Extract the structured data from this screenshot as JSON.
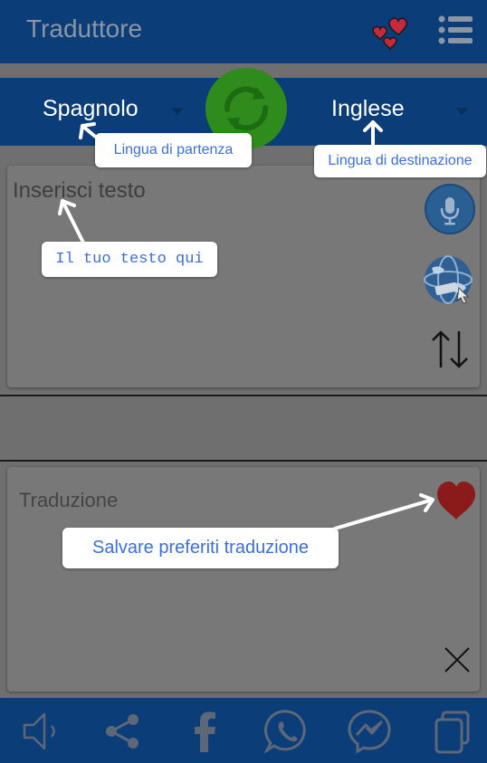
{
  "app": {
    "title": "Traduttore"
  },
  "languages": {
    "source": "Spagnolo",
    "target": "Inglese"
  },
  "input": {
    "placeholder": "Inserisci testo"
  },
  "output": {
    "label": "Traduzione"
  },
  "tooltips": {
    "source": "Lingua di partenza",
    "target": "Lingua di destinazione",
    "text": "Il tuo testo qui",
    "favorite": "Salvare preferiti traduzione"
  },
  "icons": {
    "header": [
      "hearts-icon",
      "menu-icon"
    ],
    "input_tools": [
      "microphone-icon",
      "globe-icon",
      "swap-arrows-icon"
    ],
    "output_tools": [
      "heart-icon",
      "close-icon"
    ],
    "bottom_bar": [
      "speaker-icon",
      "share-icon",
      "facebook-icon",
      "whatsapp-icon",
      "messenger-icon",
      "copy-icon"
    ]
  },
  "colors": {
    "primary": "#0b3e79",
    "swap_button": "#2e8b1c",
    "tooltip_text": "#3a6fe0",
    "heart": "#8b1a1a"
  }
}
